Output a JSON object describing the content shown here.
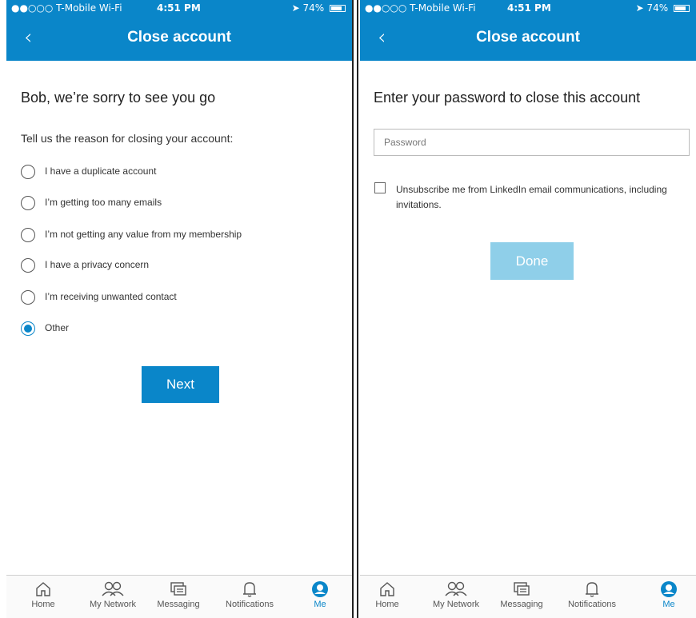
{
  "status_bar": {
    "carrier": "●●○○○ T-Mobile Wi-Fi",
    "time": "4:51 PM",
    "battery": "74%"
  },
  "left_screen": {
    "nav_title": "Close account",
    "back_label": "‹",
    "heading": "Bob, we’re sorry to see you go",
    "subheading": "Tell us the reason for closing your account:",
    "reasons": [
      {
        "label": "I have a duplicate account",
        "selected": false
      },
      {
        "label": "I’m getting too many emails",
        "selected": false
      },
      {
        "label": "I’m not getting any value from my membership",
        "selected": false
      },
      {
        "label": "I have a privacy concern",
        "selected": false
      },
      {
        "label": "I’m receiving unwanted contact",
        "selected": false
      },
      {
        "label": "Other",
        "selected": true
      }
    ],
    "next_label": "Next"
  },
  "right_screen": {
    "nav_title": "Close account",
    "back_label": "‹",
    "heading": "Enter your password to close this account",
    "password_placeholder": "Password",
    "password_value": "",
    "unsubscribe_label": "Unsubscribe me from LinkedIn email communications, including invitations.",
    "done_label": "Done"
  },
  "tabbar": {
    "items": [
      {
        "label": "Home",
        "icon": "home-icon",
        "active": false
      },
      {
        "label": "My Network",
        "icon": "network-icon",
        "active": false
      },
      {
        "label": "Messaging",
        "icon": "messaging-icon",
        "active": false
      },
      {
        "label": "Notifications",
        "icon": "bell-icon",
        "active": false
      },
      {
        "label": "Me",
        "icon": "me-icon",
        "active": true
      }
    ]
  },
  "colors": {
    "accent": "#0a86c9",
    "done_disabled": "#8fcfe9"
  }
}
